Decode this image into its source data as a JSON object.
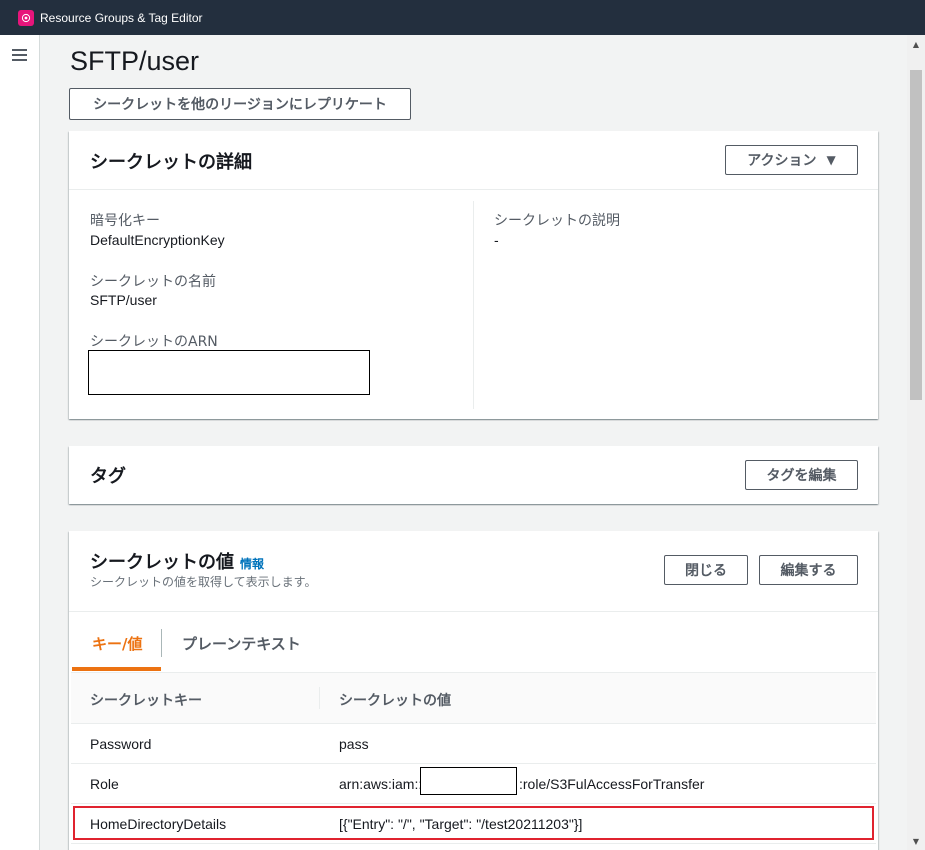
{
  "app": {
    "title": "Resource Groups & Tag Editor"
  },
  "icons": {
    "app_logo": "resource-groups-icon",
    "menu": "hamburger-menu-icon",
    "dropdown": "caret-down-icon"
  },
  "page": {
    "title": "SFTP/user",
    "replicate_button": "シークレットを他のリージョンにレプリケート"
  },
  "details": {
    "title": "シークレットの詳細",
    "actions_button": "アクション",
    "encryption_key_label": "暗号化キー",
    "encryption_key_value": "DefaultEncryptionKey",
    "name_label": "シークレットの名前",
    "name_value": "SFTP/user",
    "arn_label": "シークレットのARN",
    "description_label": "シークレットの説明",
    "description_value": "-"
  },
  "tags": {
    "title": "タグ",
    "edit_button": "タグを編集"
  },
  "secret_value": {
    "title": "シークレットの値",
    "info_link": "情報",
    "subtitle": "シークレットの値を取得して表示します。",
    "close_button": "閉じる",
    "edit_button": "編集する",
    "tabs": [
      {
        "label": "キー/値",
        "active": true
      },
      {
        "label": "プレーンテキスト",
        "active": false
      }
    ],
    "columns": {
      "key": "シークレットキー",
      "value": "シークレットの値"
    },
    "rows": [
      {
        "key": "Password",
        "value": "pass"
      },
      {
        "key": "Role",
        "value_prefix": "arn:aws:iam::",
        "value_suffix": ":role/S3FulAccessForTransfer"
      },
      {
        "key": "HomeDirectoryDetails",
        "value": "[{\"Entry\": \"/\", \"Target\": \"/test20211203\"}]"
      }
    ]
  },
  "colors": {
    "topbar": "#232f3e",
    "accent": "#ec7211",
    "link": "#0073bb",
    "highlight": "#e0232f",
    "logo": "#e7157b"
  }
}
